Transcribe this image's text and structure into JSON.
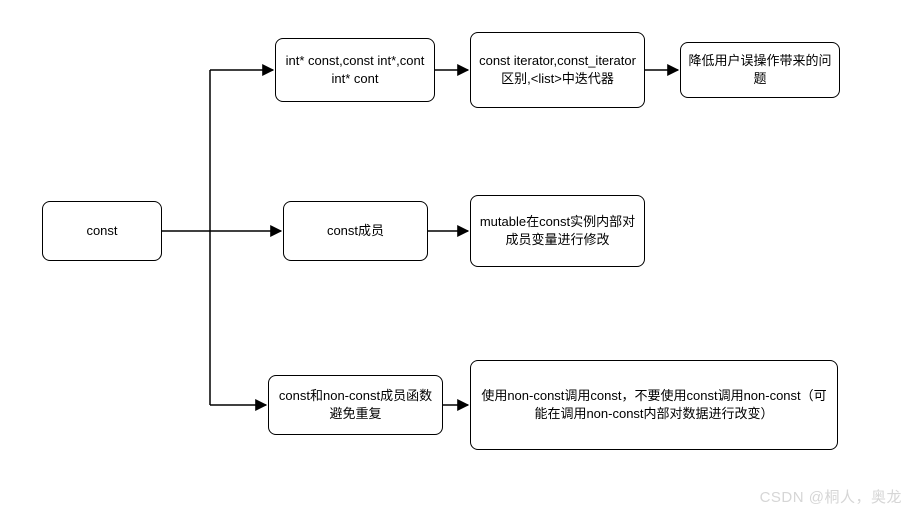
{
  "chart_data": {
    "type": "tree",
    "root": "const",
    "children": [
      {
        "label": "int* const,const int*,cont int* cont",
        "children": [
          {
            "label": "const iterator,const_iterator区别,<list>中迭代器",
            "children": [
              {
                "label": "降低用户误操作带来的问题"
              }
            ]
          }
        ]
      },
      {
        "label": "const成员",
        "children": [
          {
            "label": "mutable在const实例内部对成员变量进行修改"
          }
        ]
      },
      {
        "label": "const和non-const成员函数避免重复",
        "children": [
          {
            "label": "使用non-const调用const，不要使用const调用non-const（可能在调用non-const内部对数据进行改变）"
          }
        ]
      }
    ]
  },
  "nodes": {
    "root": "const",
    "b1": "int* const,const int*,cont int* cont",
    "b1c": "const iterator,const_iterator区别,<list>中迭代器",
    "b1d": "降低用户误操作带来的问题",
    "b2": "const成员",
    "b2c": "mutable在const实例内部对成员变量进行修改",
    "b3": "const和non-const成员函数避免重复",
    "b3c": "使用non-const调用const，不要使用const调用non-const（可能在调用non-const内部对数据进行改变）"
  },
  "watermark": "CSDN @桐人，奥龙"
}
